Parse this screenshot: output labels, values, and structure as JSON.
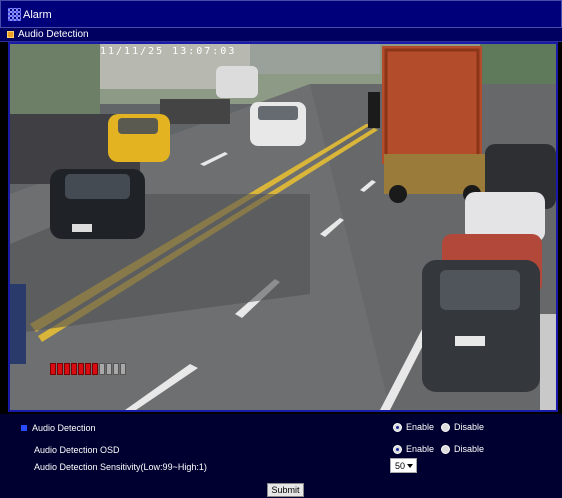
{
  "window": {
    "title": "Alarm"
  },
  "section": {
    "title": "Audio Detection"
  },
  "video": {
    "timestamp": "11/11/25  13:07:03",
    "audio_level": {
      "lit_segments": 7,
      "total_segments": 11
    },
    "meter_colors": {
      "on": "#d80c12",
      "off": "#a8a8a8"
    }
  },
  "settings": {
    "audio_detection": {
      "label": "Audio Detection",
      "enable": "Enable",
      "disable": "Disable",
      "selected": "Enable"
    },
    "osd": {
      "label": "Audio Detection OSD",
      "enable": "Enable",
      "disable": "Disable",
      "selected": "Enable"
    },
    "sensitivity": {
      "label": "Audio Detection Sensitivity(Low:99~High:1)",
      "value": "50"
    },
    "submit_label": "Submit"
  },
  "colors": {
    "title_bar": "#00007a",
    "panel": "#000030",
    "accent": "#f0a020"
  }
}
